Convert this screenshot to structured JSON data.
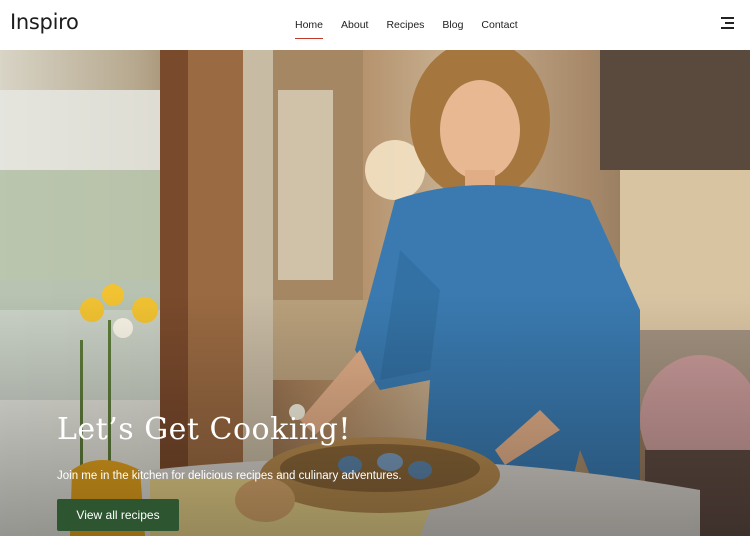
{
  "site": {
    "logo": "Inspiro"
  },
  "nav": {
    "items": [
      {
        "label": "Home",
        "active": true
      },
      {
        "label": "About"
      },
      {
        "label": "Recipes"
      },
      {
        "label": "Blog"
      },
      {
        "label": "Contact"
      }
    ],
    "menu_icon": "hamburger-menu-icon"
  },
  "hero": {
    "title": "Let’s Get Cooking!",
    "subtitle": "Join me in the kitchen for delicious recipes and culinary adventures.",
    "button_label": "View all recipes",
    "button_color": "#2c5530",
    "accent_color": "#c0392b"
  }
}
